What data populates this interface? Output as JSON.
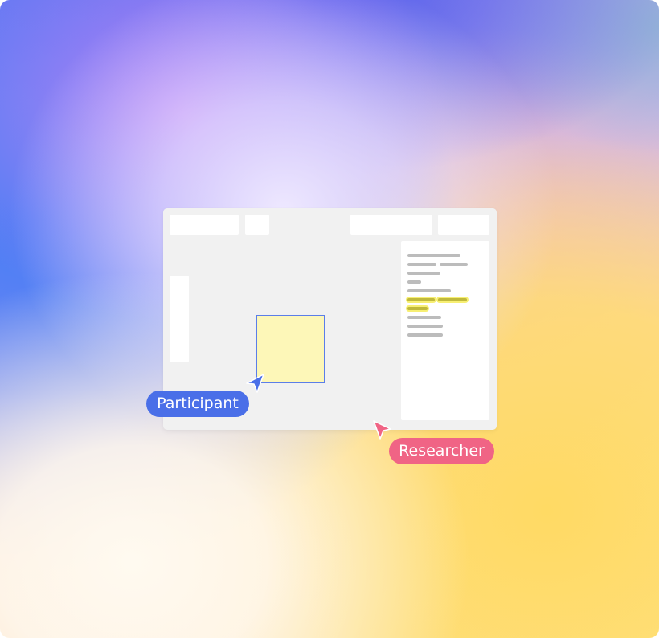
{
  "participant": {
    "label": "Participant",
    "color": "#4a6fe8"
  },
  "researcher": {
    "label": "Researcher",
    "color": "#f06485"
  },
  "sticky_note": {
    "color": "#fdf7b8"
  },
  "icons": {
    "participant_cursor": "cursor-arrow-icon",
    "researcher_cursor": "cursor-arrow-icon"
  }
}
